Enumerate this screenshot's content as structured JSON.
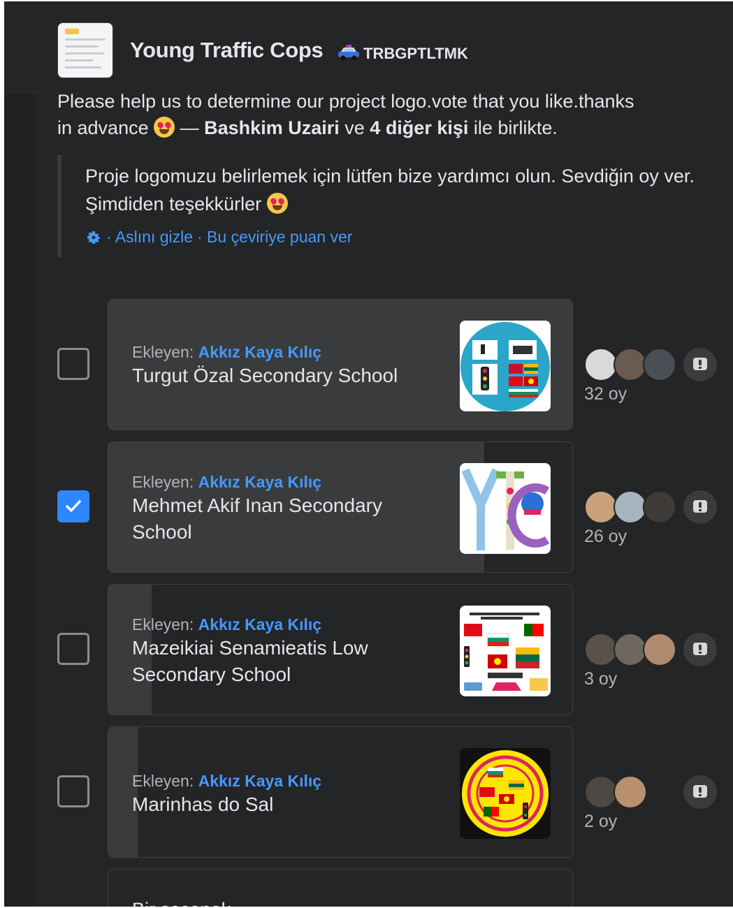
{
  "header": {
    "group_name": "Young Traffic Cops",
    "group_suffix": "TRBGPTLTMK",
    "car_icon": "police-car-icon"
  },
  "post": {
    "text_line1": "Please help us to determine our project logo.vote that  you like.thanks",
    "text_in_advance": "in advance",
    "emoji": "star-struck-emoji",
    "dash": "—",
    "tag1": "Bashkim Uzairi",
    "conj": "ve",
    "tag2": "4 diğer kişi",
    "tail": "ile birlikte."
  },
  "translation": {
    "text": "Proje logomuzu belirlemek için lütfen bize yardımcı olun. Sevdiğin oy ver. Şimdiden teşekkürler",
    "hide_original": "· Aslını gizle",
    "rate_translation": "· Bu çeviriye puan ver"
  },
  "poll": {
    "options": [
      {
        "added_by_label": "Ekleyen:",
        "added_by": "Akkız Kaya Kılıç",
        "label": "Turgut Özal Secondary School",
        "votes": "32 oy",
        "vote_share": 1.0,
        "checked": false
      },
      {
        "added_by_label": "Ekleyen:",
        "added_by": "Akkız Kaya Kılıç",
        "label": "Mehmet Akif Inan Secondary School",
        "votes": "26 oy",
        "vote_share": 0.81,
        "checked": true
      },
      {
        "added_by_label": "Ekleyen:",
        "added_by": "Akkız Kaya Kılıç",
        "label": "Mazeikiai Senamieatis Low Secondary School",
        "votes": "3 oy",
        "vote_share": 0.094,
        "checked": false
      },
      {
        "added_by_label": "Ekleyen:",
        "added_by": "Akkız Kaya Kılıç",
        "label": "Marinhas do Sal",
        "votes": "2 oy",
        "vote_share": 0.0625,
        "checked": false
      }
    ],
    "next_option_partial": "Bir seçenek..."
  },
  "colors": {
    "accent": "#4599ff",
    "checkbox_checked": "#2d88ff",
    "bg": "#242526"
  }
}
